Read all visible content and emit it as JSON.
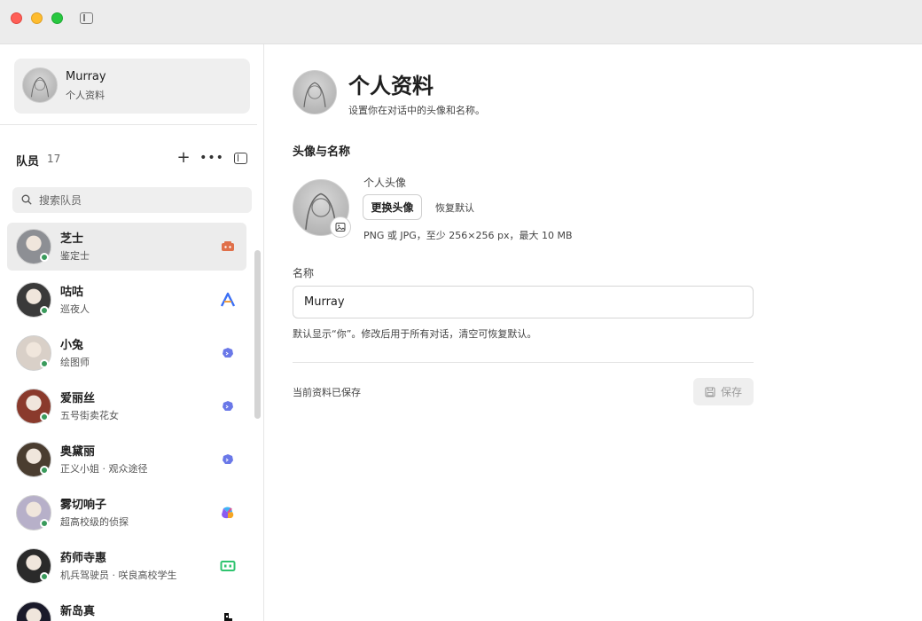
{
  "profile": {
    "name": "Murray",
    "subtitle": "个人资料"
  },
  "team": {
    "title": "队员",
    "count": "17",
    "search_placeholder": "搜索队员",
    "members": [
      {
        "name": "芝士",
        "role": "鉴定士",
        "badge_icon": "robot-icon",
        "badge_color": "#e0704a",
        "active": true
      },
      {
        "name": "咕咕",
        "role": "巡夜人",
        "badge_icon": "a-logo-icon",
        "badge_color": "#3b6ff5"
      },
      {
        "name": "小兔",
        "role": "绘图师",
        "badge_icon": "chat-bubble-icon",
        "badge_color": "#6a78e8"
      },
      {
        "name": "爱丽丝",
        "role": "五号街卖花女",
        "badge_icon": "chat-bubble-icon",
        "badge_color": "#6a78e8"
      },
      {
        "name": "奥黛丽",
        "role": "正义小姐 · 观众途径",
        "badge_icon": "chat-bubble-icon",
        "badge_color": "#6a78e8"
      },
      {
        "name": "雾切响子",
        "role": "超高校级的侦探",
        "badge_icon": "copilot-icon",
        "badge_color": "#8a5cf0"
      },
      {
        "name": "药师寺惠",
        "role": "机兵驾驶员 · 咲良高校学生",
        "badge_icon": "terminal-icon",
        "badge_color": "#2fc46f"
      },
      {
        "name": "新岛真",
        "role": "",
        "badge_icon": "pixel-icon",
        "badge_color": "#111111"
      }
    ]
  },
  "main": {
    "title": "个人资料",
    "subtitle": "设置你在对话中的头像和名称。",
    "section_title": "头像与名称",
    "avatar_label": "个人头像",
    "change_avatar": "更换头像",
    "reset_default": "恢复默认",
    "avatar_hint": "PNG 或 JPG，至少 256×256 px，最大 10 MB",
    "name_label": "名称",
    "name_value": "Murray",
    "name_hint": "默认显示“你”。修改后用于所有对话，清空可恢复默认。",
    "status": "当前资料已保存",
    "save": "保存"
  }
}
